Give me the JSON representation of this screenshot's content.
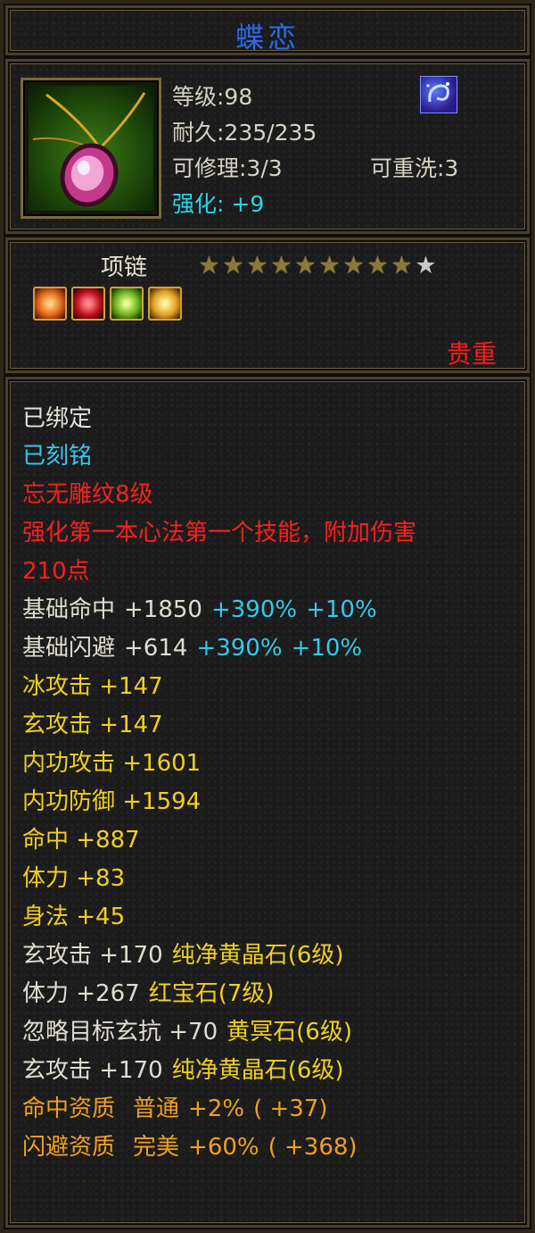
{
  "title": "蝶恋",
  "info": {
    "level": "等级:98",
    "durability": "耐久:235/235",
    "repairable": "可修理:3/3",
    "rewashable": "可重洗:3",
    "enhance": "强化: +9"
  },
  "type": {
    "label": "项链",
    "stars_filled": 9,
    "stars_total": 10,
    "rarity": "贵重"
  },
  "status": {
    "bound": "已绑定",
    "engraved": "已刻铭"
  },
  "engraving": {
    "name": "忘无雕纹8级",
    "effect_line1": "强化第一本心法第一个技能，附加伤害",
    "effect_line2": "210点"
  },
  "base_stats": [
    {
      "name": "基础命中",
      "value": "+1850",
      "bonus1": "+390%",
      "bonus2": "+10%"
    },
    {
      "name": "基础闪避",
      "value": "+614",
      "bonus1": "+390%",
      "bonus2": "+10%"
    }
  ],
  "attributes": [
    "冰攻击 +147",
    "玄攻击 +147",
    "内功攻击 +1601",
    "内功防御 +1594",
    "命中 +887",
    "体力 +83",
    "身法 +45"
  ],
  "gem_stats": [
    {
      "stat": "玄攻击 +170",
      "gem": "纯净黄晶石(6级)"
    },
    {
      "stat": "体力 +267",
      "gem": "红宝石(7级)"
    },
    {
      "stat": "忽略目标玄抗 +70",
      "gem": "黄冥石(6级)"
    },
    {
      "stat": "玄攻击 +170",
      "gem": "纯净黄晶石(6级)"
    }
  ],
  "aptitudes": [
    {
      "name": "命中资质",
      "grade": "普通",
      "value": "+2%",
      "extra": "( +37)"
    },
    {
      "name": "闪避资质",
      "grade": "完美",
      "value": "+60%",
      "extra": "( +368)"
    }
  ],
  "colors": {
    "title": "#2f6ad8",
    "enhance": "#2ad4e8",
    "rarity": "#ff1a1a",
    "engraving": "#ff1e1e",
    "bonus": "#35c8ec",
    "attribute": "#f0d020",
    "aptitude": "#f0a020"
  },
  "icons": {
    "item": "pink-gem-necklace-icon",
    "badge": "blue-swirl-badge-icon",
    "gems": [
      "orange-gem-icon",
      "red-gem-icon",
      "green-gem-icon",
      "yellow-gem-icon"
    ]
  }
}
